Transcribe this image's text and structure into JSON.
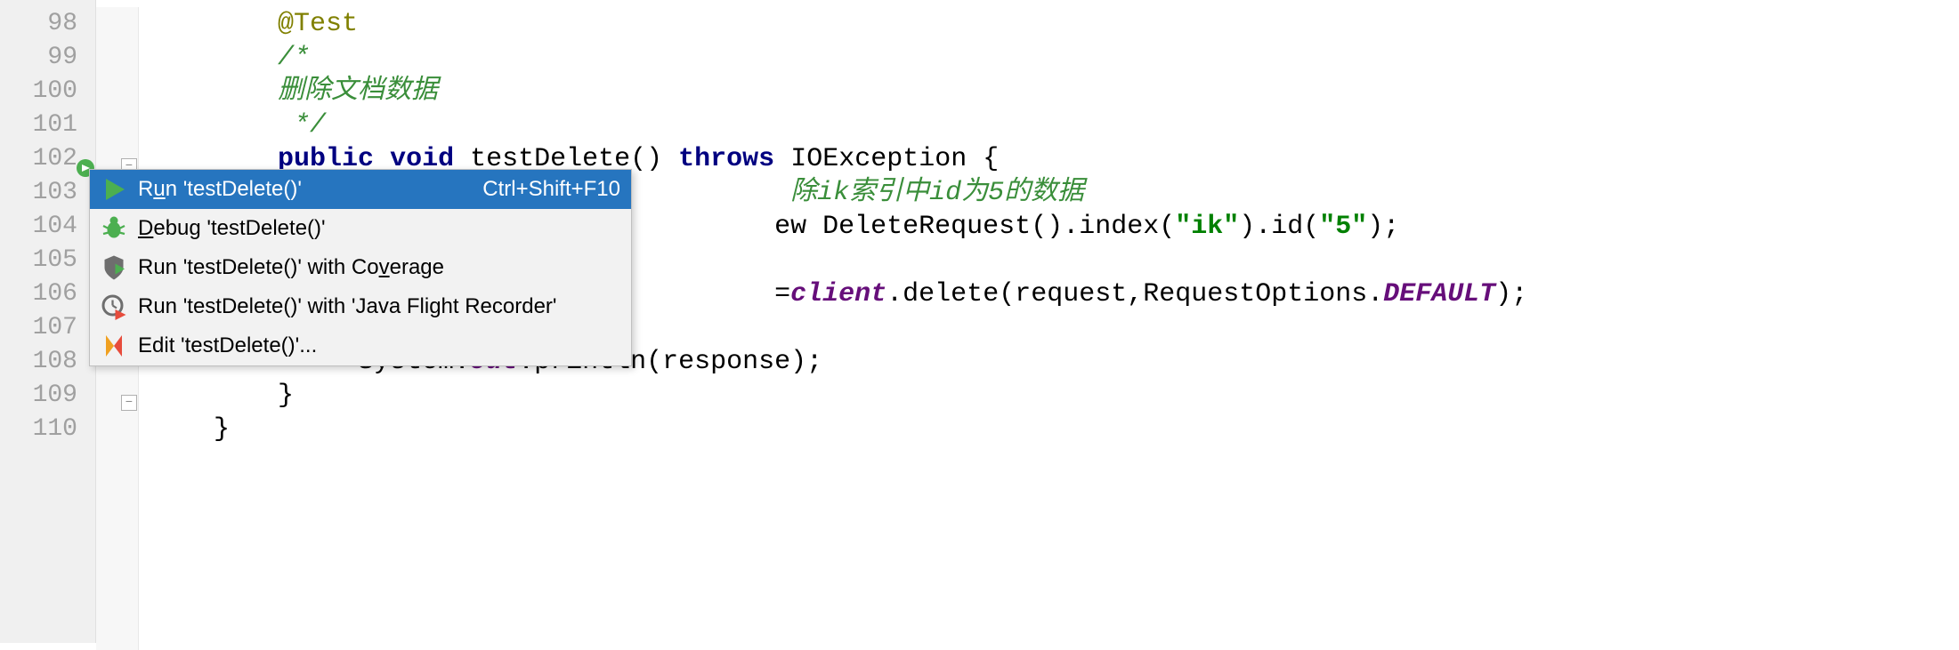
{
  "gutter": {
    "lines": [
      "98",
      "99",
      "100",
      "101",
      "102",
      "103",
      "104",
      "105",
      "106",
      "107",
      "108",
      "109",
      "110"
    ]
  },
  "code": {
    "l98_annotation": "@Test",
    "l99_comment_open": "/*",
    "l100_comment_text": "删除文档数据",
    "l101_comment_close": " */",
    "l102_kw_public": "public",
    "l102_kw_void": "void",
    "l102_method": "testDelete",
    "l102_kw_throws": "throws",
    "l102_exc": "IOException",
    "l103_comment_tail": "除ik索引中id为5的数据",
    "l104_pre": "ew ",
    "l104_class": "DeleteRequest",
    "l104_index": ".index(",
    "l104_str1": "\"ik\"",
    "l104_id": ").id(",
    "l104_str2": "\"5\"",
    "l104_end": ");",
    "l106_pre": "=",
    "l106_client": "client",
    "l106_call": ".delete(request,RequestOptions.",
    "l106_default": "DEFAULT",
    "l106_end": ");",
    "l108_sys": "System.",
    "l108_out": "out",
    "l108_println": ".println(response);",
    "l109_brace": "}",
    "l110_brace": "}"
  },
  "menu": {
    "run_pre": "R",
    "run_u": "u",
    "run_post": "n 'testDelete()'",
    "run_shortcut": "Ctrl+Shift+F10",
    "debug_u": "D",
    "debug_post": "ebug 'testDelete()'",
    "coverage_pre": "Run 'testDelete()' with Co",
    "coverage_u": "v",
    "coverage_post": "erage",
    "jfr": "Run 'testDelete()' with 'Java Flight Recorder'",
    "edit": "Edit 'testDelete()'..."
  }
}
